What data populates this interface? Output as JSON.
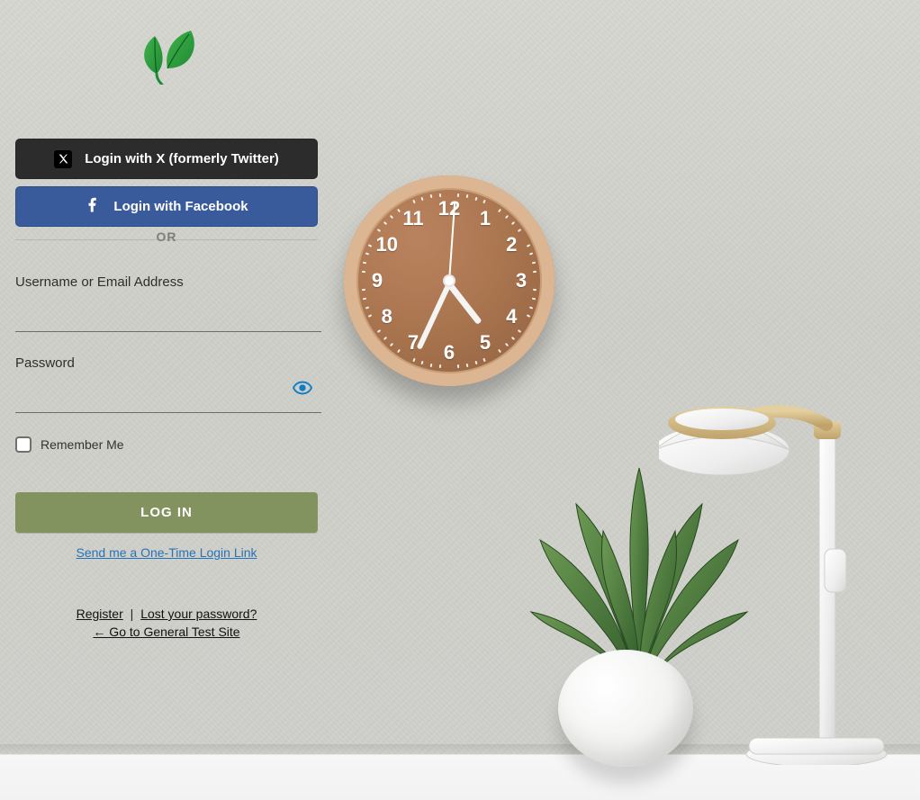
{
  "social": {
    "x_label": "Login with X (formerly Twitter)",
    "fb_label": "Login with Facebook"
  },
  "divider": {
    "or": "OR"
  },
  "form": {
    "username_label": "Username or Email Address",
    "password_label": "Password",
    "remember_label": "Remember Me",
    "submit_label": "LOG IN",
    "one_time_link": "Send me a One-Time Login Link"
  },
  "links": {
    "register": "Register",
    "lost_password": "Lost your password?",
    "back": "← Go to General Test Site"
  }
}
